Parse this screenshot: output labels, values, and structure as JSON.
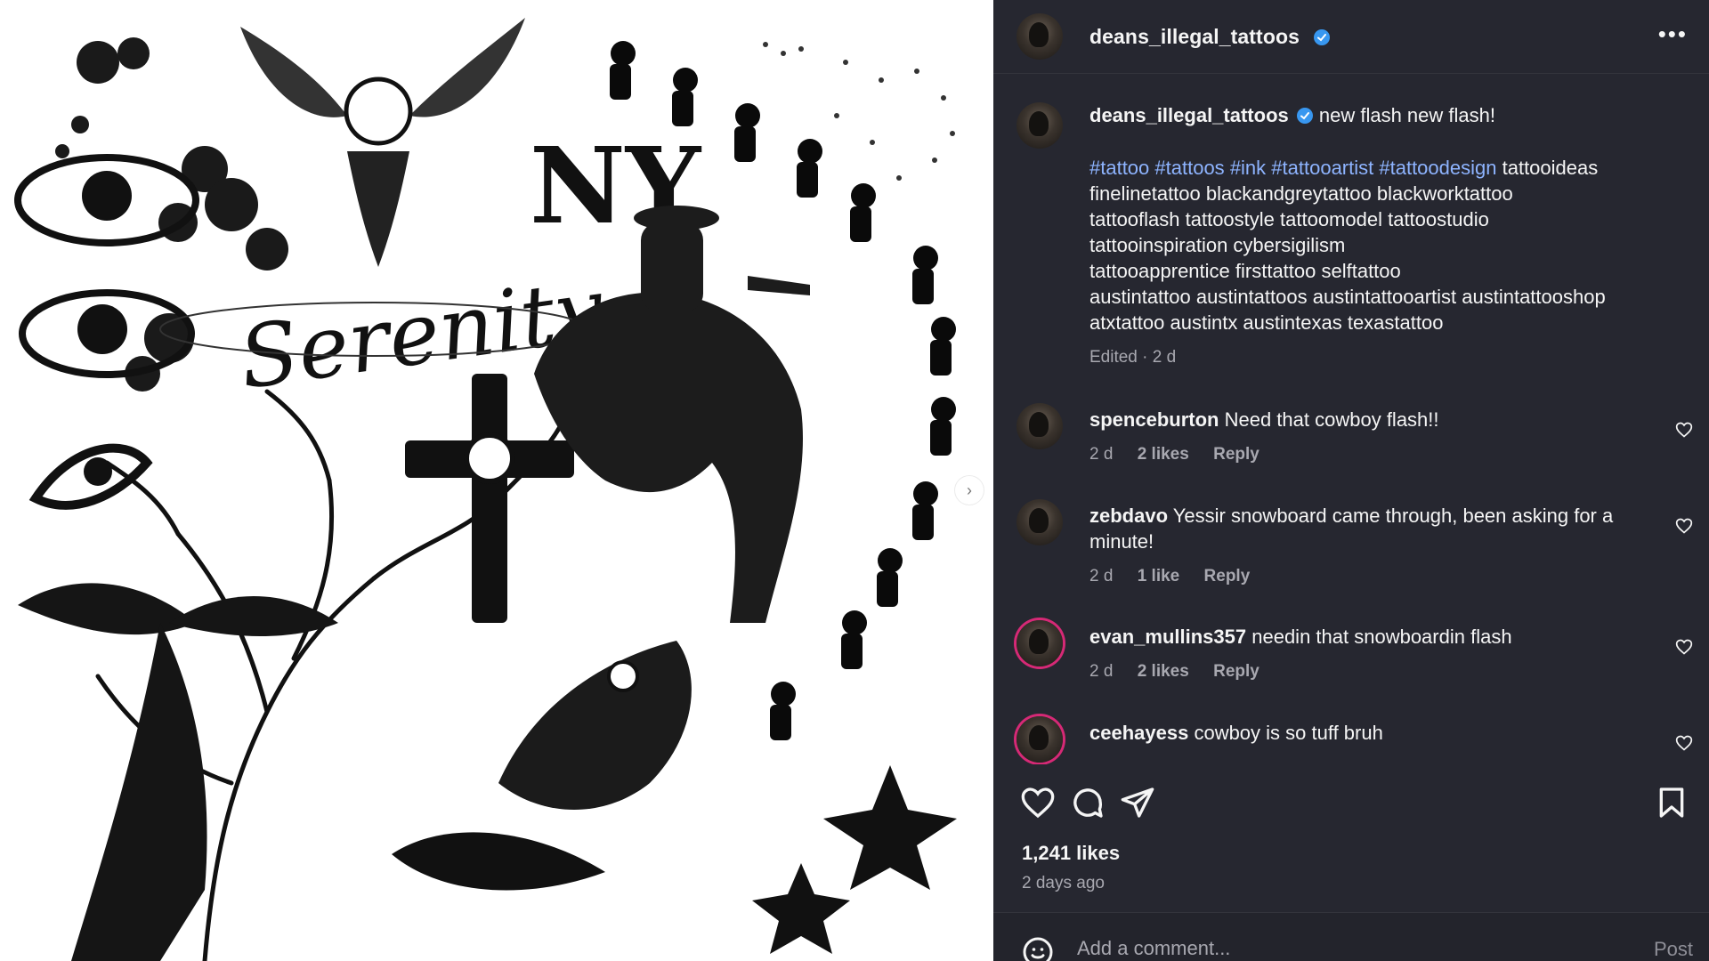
{
  "colors": {
    "panel_bg": "#262730",
    "hashtag": "#8eb4ff",
    "verified": "#3897f0",
    "muted": "#a8a8b0"
  },
  "media": {
    "artwork_text": "Serenity",
    "next_icon": "chevron-right-icon"
  },
  "header": {
    "username": "deans_illegal_tattoos",
    "more_icon": "more-horizontal-icon"
  },
  "caption": {
    "username": "deans_illegal_tattoos",
    "text": "new flash new flash!",
    "hashtags": [
      "#tattoo",
      "#tattoos",
      "#ink",
      "#tattooartist",
      "#tattoodesign"
    ],
    "lines": [
      "tattooideas",
      "finelinetattoo blackandgreytattoo blackworktattoo",
      "tattooflash tattoostyle tattoomodel tattoostudio",
      "tattooinspiration cybersigilism",
      "tattooapprentice firsttattoo selftattoo",
      "austintattoo austintattoos austintattooartist austintattooshop",
      "atxtattoo austintx austintexas texastattoo"
    ],
    "meta": "Edited · 2 d"
  },
  "comments": [
    {
      "username": "spenceburton",
      "text": "Need that cowboy flash!!",
      "time": "2 d",
      "likes": "2 likes",
      "reply": "Reply"
    },
    {
      "username": "zebdavo",
      "text": "Yessir snowboard came through, been asking for a minute!",
      "time": "2 d",
      "likes": "1 like",
      "reply": "Reply"
    },
    {
      "username": "evan_mullins357",
      "text": "needin that snowboardin flash",
      "time": "2 d",
      "likes": "2 likes",
      "reply": "Reply"
    },
    {
      "username": "ceehayess",
      "text": "cowboy is so tuff bruh",
      "time": "",
      "likes": "",
      "reply": ""
    }
  ],
  "actions": {
    "like_icon": "heart-icon",
    "comment_icon": "comment-icon",
    "share_icon": "send-icon",
    "save_icon": "bookmark-icon"
  },
  "stats": {
    "likes": "1,241 likes",
    "ago": "2 days ago"
  },
  "composer": {
    "placeholder": "Add a comment...",
    "post_label": "Post",
    "emoji_icon": "emoji-icon"
  }
}
